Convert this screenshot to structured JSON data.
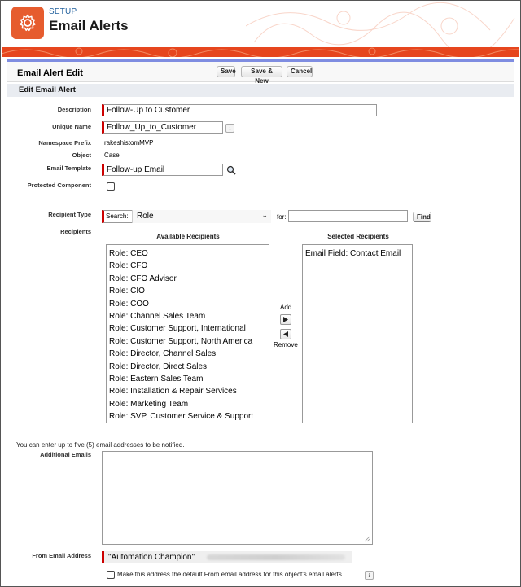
{
  "header": {
    "breadcrumb": "SETUP",
    "title": "Email Alerts",
    "app_icon": "gear-icon",
    "accent": "#e65c2e"
  },
  "page_block": {
    "title": "Email Alert Edit",
    "buttons": {
      "save": "Save",
      "save_new": "Save & New",
      "cancel": "Cancel"
    }
  },
  "section": {
    "title": "Edit Email Alert"
  },
  "fields": {
    "description": {
      "label": "Description",
      "value": "Follow-Up to Customer"
    },
    "unique_name": {
      "label": "Unique Name",
      "value": "Follow_Up_to_Customer",
      "info": "i"
    },
    "namespace_prefix": {
      "label": "Namespace Prefix",
      "value": "rakeshistomMVP"
    },
    "object": {
      "label": "Object",
      "value": "Case"
    },
    "email_template": {
      "label": "Email Template",
      "value": "Follow-up Email"
    },
    "protected_component": {
      "label": "Protected Component",
      "checked": false
    }
  },
  "recipients": {
    "type_label": "Recipient Type",
    "search_label": "Search:",
    "search_select": "Role",
    "for_label": "for:",
    "for_value": "",
    "find_button": "Find",
    "recipients_label": "Recipients",
    "available_header": "Available Recipients",
    "selected_header": "Selected Recipients",
    "add_label": "Add",
    "remove_label": "Remove",
    "available": [
      "Role: CEO",
      "Role: CFO",
      "Role: CFO Advisor",
      "Role: CIO",
      "Role: COO",
      "Role: Channel Sales Team",
      "Role: Customer Support, International",
      "Role: Customer Support, North America",
      "Role: Director, Channel Sales",
      "Role: Director, Direct Sales",
      "Role: Eastern Sales Team",
      "Role: Installation & Repair Services",
      "Role: Marketing Team",
      "Role: SVP, Customer Service & Support"
    ],
    "selected": [
      "Email Field: Contact Email"
    ]
  },
  "emails": {
    "note": "You can enter up to five (5) email addresses to be notified.",
    "additional_label": "Additional Emails",
    "additional_value": ""
  },
  "from": {
    "label": "From Email Address",
    "value": "\"Automation Champion\"",
    "default_checkbox_label": "Make this address the default From email address for this object's email alerts.",
    "default_checked": false,
    "info": "i"
  }
}
